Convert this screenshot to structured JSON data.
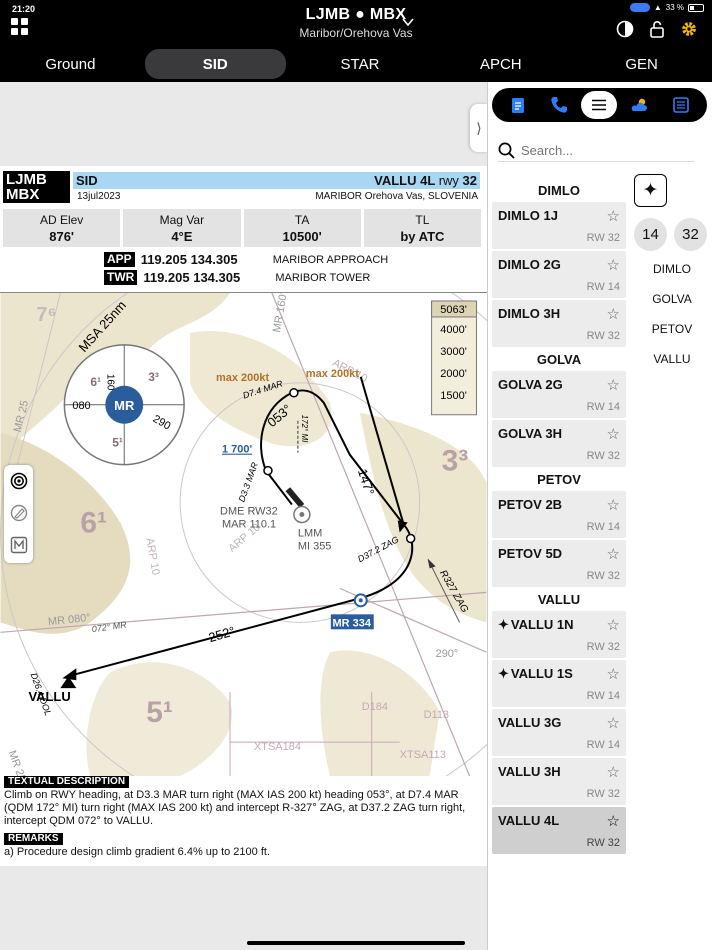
{
  "status_bar": {
    "time": "21:20",
    "battery": "33 %"
  },
  "header": {
    "title": "LJMB ● MBX",
    "subtitle": "Maribor/Orehova Vas"
  },
  "tabs": [
    {
      "label": "Ground",
      "active": false
    },
    {
      "label": "SID",
      "active": true
    },
    {
      "label": "STAR",
      "active": false
    },
    {
      "label": "APCH",
      "active": false
    },
    {
      "label": "GEN",
      "active": false
    }
  ],
  "chart": {
    "icao": "LJMB",
    "iata": "MBX",
    "type": "SID",
    "procedure": "VALLU 4L",
    "rwy_prefix": "rwy",
    "rwy": "32",
    "date": "13jul2023",
    "airport_name": "MARIBOR Orehova Vas, SLOVENIA",
    "info": [
      {
        "label": "AD Elev",
        "value": "876'"
      },
      {
        "label": "Mag Var",
        "value": "4°E"
      },
      {
        "label": "TA",
        "value": "10500'"
      },
      {
        "label": "TL",
        "value": "by ATC"
      }
    ],
    "frequencies": [
      {
        "tag": "APP",
        "freqs": "119.205 134.305",
        "name": "MARIBOR APPROACH"
      },
      {
        "tag": "TWR",
        "freqs": "119.205 134.305",
        "name": "MARIBOR TOWER"
      }
    ],
    "map": {
      "elev_legend": [
        "5063'",
        "4000'",
        "3000'",
        "2000'",
        "1500'"
      ],
      "msa_label": "MSA 25nm",
      "msa_center": "MR",
      "msa_values": [
        "6¹",
        "3³",
        "5¹"
      ],
      "msa_bearings": [
        "160",
        "080",
        "290"
      ],
      "labels": {
        "speed1": "max 200kt",
        "speed2": "max 200kt",
        "d74": "D7.4 MAR",
        "d33": "D3.3 MAR",
        "d372": "D37.2 ZAG",
        "d264": "D26.4 DOL",
        "alt1700": "1 700'",
        "hdg053": "053°",
        "trk147": "147°",
        "trk252": "252°",
        "qdm172": "172° MI",
        "r327": "R327 ZAG",
        "mr160": "MR 160°",
        "mr080": "MR 080°",
        "mr25": "MR 25",
        "arp10a": "ARP 10",
        "arp10b": "ARP 10",
        "arp10c": "ARP 10",
        "d290": "290°",
        "d072": "072° MR",
        "dme": "DME RW32",
        "dme_freq": "MAR 110.1",
        "lmm": "LMM",
        "lmm_freq": "MI 355",
        "mr334": "MR 334",
        "vallu": "VALLU",
        "d184": "D184",
        "d113": "D113",
        "xtsa184": "XTSA184",
        "xtsa113": "XTSA113",
        "mr_left": "MR 25",
        "sector_a": "7⁶",
        "sector_b": "6¹",
        "sector_c": "3³",
        "sector_d": "5¹"
      }
    },
    "textual_title": "TEXTUAL DESCRIPTION",
    "textual_lines": [
      "Climb on RWY heading, at D3.3 MAR turn right (MAX IAS 200 kt) heading 053°, at D7.4 MAR",
      "(QDM 172° MI) turn right (MAX IAS 200 kt) and intercept R-327° ZAG, at D37.2 ZAG turn right,",
      "intercept QDM 072° to VALLU."
    ],
    "remarks_title": "REMARKS",
    "remarks_text": "a) Procedure design climb gradient 6.4% up to 2100 ft."
  },
  "panel": {
    "search_placeholder": "Search...",
    "groups": [
      {
        "title": "DIMLO",
        "items": [
          {
            "name": "DIMLO 1J",
            "rwy": "RW 32",
            "fav": false,
            "selected": false
          },
          {
            "name": "DIMLO 2G",
            "rwy": "RW 14",
            "fav": false,
            "selected": false
          },
          {
            "name": "DIMLO 3H",
            "rwy": "RW 32",
            "fav": false,
            "selected": false
          }
        ]
      },
      {
        "title": "GOLVA",
        "items": [
          {
            "name": "GOLVA 2G",
            "rwy": "RW 14",
            "fav": false,
            "selected": false
          },
          {
            "name": "GOLVA 3H",
            "rwy": "RW 32",
            "fav": false,
            "selected": false
          }
        ]
      },
      {
        "title": "PETOV",
        "items": [
          {
            "name": "PETOV 2B",
            "rwy": "RW 14",
            "fav": false,
            "selected": false
          },
          {
            "name": "PETOV 5D",
            "rwy": "RW 32",
            "fav": false,
            "selected": false
          }
        ]
      },
      {
        "title": "VALLU",
        "items": [
          {
            "name": "VALLU 1N",
            "rwy": "RW 32",
            "fav": true,
            "selected": false
          },
          {
            "name": "VALLU 1S",
            "rwy": "RW 14",
            "fav": true,
            "selected": false
          },
          {
            "name": "VALLU 3G",
            "rwy": "RW 14",
            "fav": false,
            "selected": false
          },
          {
            "name": "VALLU 3H",
            "rwy": "RW 32",
            "fav": false,
            "selected": false
          },
          {
            "name": "VALLU 4L",
            "rwy": "RW 32",
            "fav": false,
            "selected": true
          }
        ]
      }
    ],
    "runway_filters": [
      "14",
      "32"
    ],
    "fix_filters": [
      "DIMLO",
      "GOLVA",
      "PETOV",
      "VALLU"
    ]
  },
  "colors": {
    "accent": "#2f7df6",
    "gear": "#f5b800",
    "band": "#a9d7f1",
    "msa": "#2a5d9c"
  }
}
